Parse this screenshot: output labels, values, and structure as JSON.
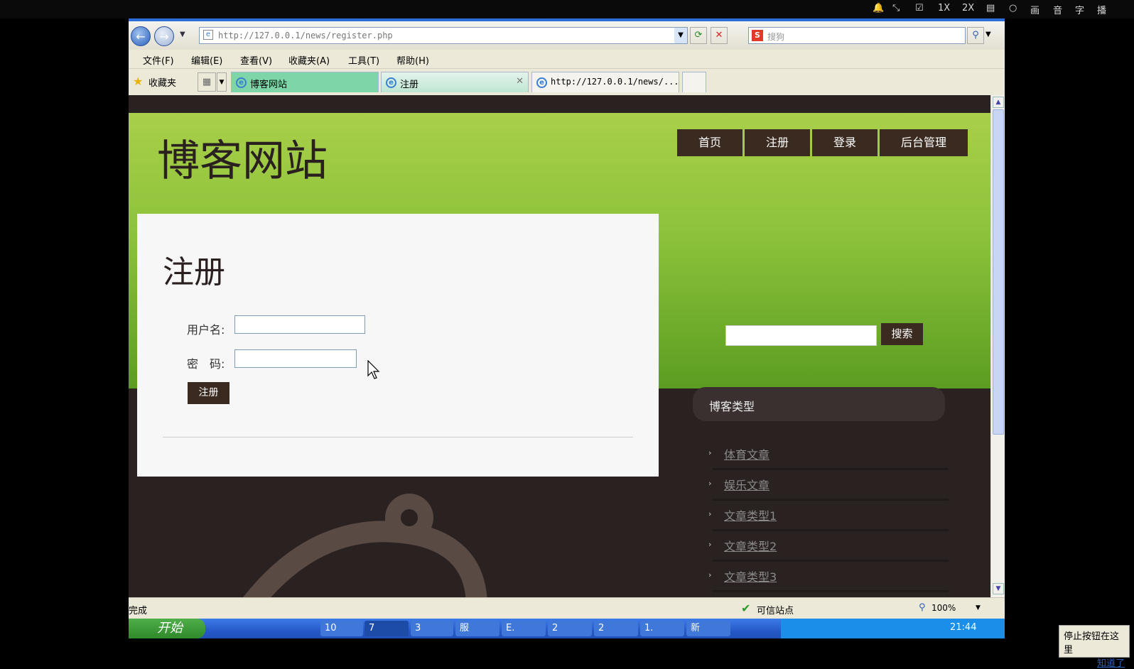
{
  "topbar": {
    "items": [
      "1X",
      "2X",
      "画",
      "音",
      "字",
      "播"
    ]
  },
  "browser": {
    "url": "http://127.0.0.1/news/register.php",
    "search_placeholder": "搜狗",
    "menu": [
      "文件(F)",
      "编辑(E)",
      "查看(V)",
      "收藏夹(A)",
      "工具(T)",
      "帮助(H)"
    ],
    "favorites_label": "收藏夹",
    "tabs": [
      {
        "label": "博客网站"
      },
      {
        "label": "注册"
      },
      {
        "label": "http://127.0.0.1/news/..."
      }
    ],
    "status": {
      "left": "完成",
      "zone": "可信站点",
      "zoom": "100%"
    }
  },
  "page": {
    "site_title": "博客网站",
    "nav": [
      "首页",
      "注册",
      "登录",
      "后台管理"
    ],
    "form": {
      "heading": "注册",
      "username_label": "用户名:",
      "password_label": "密　码:",
      "submit": "注册",
      "username_value": "",
      "password_value": ""
    },
    "search": {
      "button": "搜索",
      "value": ""
    },
    "sidebar": {
      "title": "博客类型",
      "categories": [
        "体育文章",
        "娱乐文章",
        "文章类型1",
        "文章类型2",
        "文章类型3"
      ]
    }
  },
  "taskbar": {
    "start": "开始",
    "tasks": [
      "10",
      "7",
      "3",
      "服",
      "E.",
      "2",
      "2",
      "1.",
      "新"
    ],
    "clock": "21:44"
  },
  "popup": {
    "text": "停止按钮在这里",
    "link": "知道了"
  },
  "colors": {
    "green_top": "#a9cf4a",
    "green_bottom": "#5b9d22",
    "dark": "#2a2121",
    "button": "#3a2a20"
  }
}
